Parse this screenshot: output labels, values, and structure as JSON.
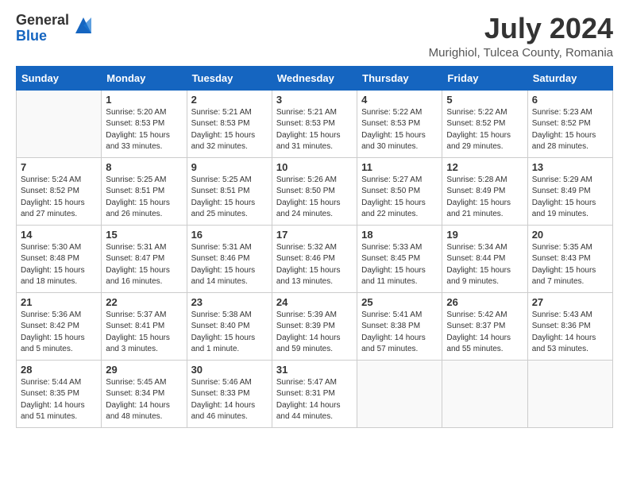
{
  "logo": {
    "general": "General",
    "blue": "Blue"
  },
  "title": "July 2024",
  "location": "Murighiol, Tulcea County, Romania",
  "weekdays": [
    "Sunday",
    "Monday",
    "Tuesday",
    "Wednesday",
    "Thursday",
    "Friday",
    "Saturday"
  ],
  "weeks": [
    [
      {
        "day": "",
        "info": ""
      },
      {
        "day": "1",
        "info": "Sunrise: 5:20 AM\nSunset: 8:53 PM\nDaylight: 15 hours\nand 33 minutes."
      },
      {
        "day": "2",
        "info": "Sunrise: 5:21 AM\nSunset: 8:53 PM\nDaylight: 15 hours\nand 32 minutes."
      },
      {
        "day": "3",
        "info": "Sunrise: 5:21 AM\nSunset: 8:53 PM\nDaylight: 15 hours\nand 31 minutes."
      },
      {
        "day": "4",
        "info": "Sunrise: 5:22 AM\nSunset: 8:53 PM\nDaylight: 15 hours\nand 30 minutes."
      },
      {
        "day": "5",
        "info": "Sunrise: 5:22 AM\nSunset: 8:52 PM\nDaylight: 15 hours\nand 29 minutes."
      },
      {
        "day": "6",
        "info": "Sunrise: 5:23 AM\nSunset: 8:52 PM\nDaylight: 15 hours\nand 28 minutes."
      }
    ],
    [
      {
        "day": "7",
        "info": "Sunrise: 5:24 AM\nSunset: 8:52 PM\nDaylight: 15 hours\nand 27 minutes."
      },
      {
        "day": "8",
        "info": "Sunrise: 5:25 AM\nSunset: 8:51 PM\nDaylight: 15 hours\nand 26 minutes."
      },
      {
        "day": "9",
        "info": "Sunrise: 5:25 AM\nSunset: 8:51 PM\nDaylight: 15 hours\nand 25 minutes."
      },
      {
        "day": "10",
        "info": "Sunrise: 5:26 AM\nSunset: 8:50 PM\nDaylight: 15 hours\nand 24 minutes."
      },
      {
        "day": "11",
        "info": "Sunrise: 5:27 AM\nSunset: 8:50 PM\nDaylight: 15 hours\nand 22 minutes."
      },
      {
        "day": "12",
        "info": "Sunrise: 5:28 AM\nSunset: 8:49 PM\nDaylight: 15 hours\nand 21 minutes."
      },
      {
        "day": "13",
        "info": "Sunrise: 5:29 AM\nSunset: 8:49 PM\nDaylight: 15 hours\nand 19 minutes."
      }
    ],
    [
      {
        "day": "14",
        "info": "Sunrise: 5:30 AM\nSunset: 8:48 PM\nDaylight: 15 hours\nand 18 minutes."
      },
      {
        "day": "15",
        "info": "Sunrise: 5:31 AM\nSunset: 8:47 PM\nDaylight: 15 hours\nand 16 minutes."
      },
      {
        "day": "16",
        "info": "Sunrise: 5:31 AM\nSunset: 8:46 PM\nDaylight: 15 hours\nand 14 minutes."
      },
      {
        "day": "17",
        "info": "Sunrise: 5:32 AM\nSunset: 8:46 PM\nDaylight: 15 hours\nand 13 minutes."
      },
      {
        "day": "18",
        "info": "Sunrise: 5:33 AM\nSunset: 8:45 PM\nDaylight: 15 hours\nand 11 minutes."
      },
      {
        "day": "19",
        "info": "Sunrise: 5:34 AM\nSunset: 8:44 PM\nDaylight: 15 hours\nand 9 minutes."
      },
      {
        "day": "20",
        "info": "Sunrise: 5:35 AM\nSunset: 8:43 PM\nDaylight: 15 hours\nand 7 minutes."
      }
    ],
    [
      {
        "day": "21",
        "info": "Sunrise: 5:36 AM\nSunset: 8:42 PM\nDaylight: 15 hours\nand 5 minutes."
      },
      {
        "day": "22",
        "info": "Sunrise: 5:37 AM\nSunset: 8:41 PM\nDaylight: 15 hours\nand 3 minutes."
      },
      {
        "day": "23",
        "info": "Sunrise: 5:38 AM\nSunset: 8:40 PM\nDaylight: 15 hours\nand 1 minute."
      },
      {
        "day": "24",
        "info": "Sunrise: 5:39 AM\nSunset: 8:39 PM\nDaylight: 14 hours\nand 59 minutes."
      },
      {
        "day": "25",
        "info": "Sunrise: 5:41 AM\nSunset: 8:38 PM\nDaylight: 14 hours\nand 57 minutes."
      },
      {
        "day": "26",
        "info": "Sunrise: 5:42 AM\nSunset: 8:37 PM\nDaylight: 14 hours\nand 55 minutes."
      },
      {
        "day": "27",
        "info": "Sunrise: 5:43 AM\nSunset: 8:36 PM\nDaylight: 14 hours\nand 53 minutes."
      }
    ],
    [
      {
        "day": "28",
        "info": "Sunrise: 5:44 AM\nSunset: 8:35 PM\nDaylight: 14 hours\nand 51 minutes."
      },
      {
        "day": "29",
        "info": "Sunrise: 5:45 AM\nSunset: 8:34 PM\nDaylight: 14 hours\nand 48 minutes."
      },
      {
        "day": "30",
        "info": "Sunrise: 5:46 AM\nSunset: 8:33 PM\nDaylight: 14 hours\nand 46 minutes."
      },
      {
        "day": "31",
        "info": "Sunrise: 5:47 AM\nSunset: 8:31 PM\nDaylight: 14 hours\nand 44 minutes."
      },
      {
        "day": "",
        "info": ""
      },
      {
        "day": "",
        "info": ""
      },
      {
        "day": "",
        "info": ""
      }
    ]
  ]
}
